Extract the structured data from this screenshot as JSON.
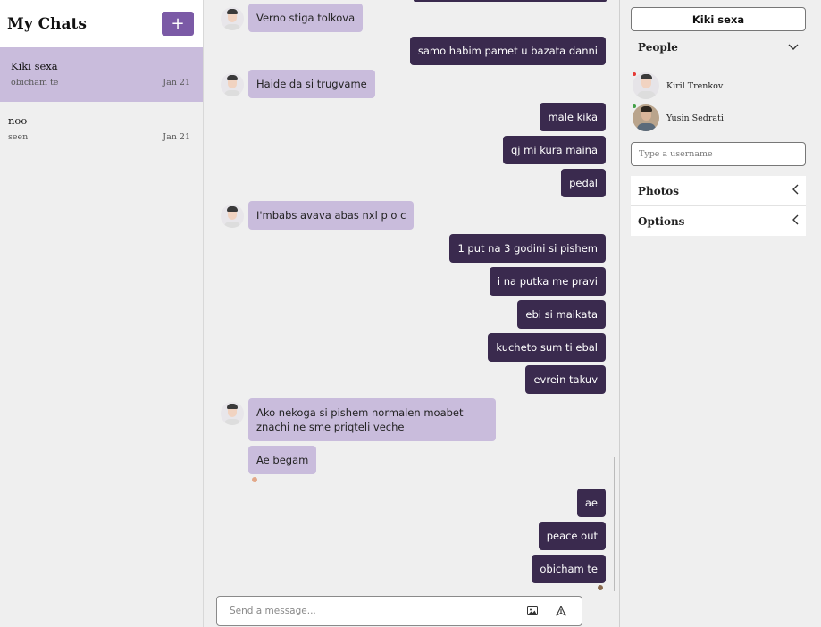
{
  "sidebar": {
    "title": "My Chats",
    "new_chat_label": "+",
    "chats": [
      {
        "name": "Kiki sexa",
        "last": "obicham te",
        "date": "Jan 21"
      },
      {
        "name": "noo",
        "last": "seen",
        "date": "Jan 21"
      }
    ]
  },
  "messages": [
    {
      "side": "in",
      "text": "Verno stiga tolkova"
    },
    {
      "side": "out",
      "text": "samo habim pamet u bazata danni"
    },
    {
      "side": "in",
      "text": "Haide da si trugvame"
    },
    {
      "side": "out",
      "text": "male kika"
    },
    {
      "side": "out",
      "text": "qj mi kura maina"
    },
    {
      "side": "out",
      "text": "pedal"
    },
    {
      "side": "in",
      "text": "I'mbabs avava abas nxl p o c"
    },
    {
      "side": "out",
      "text": "1 put na 3 godini si pishem"
    },
    {
      "side": "out",
      "text": "i na putka me pravi"
    },
    {
      "side": "out",
      "text": "ebi si maikata"
    },
    {
      "side": "out",
      "text": "kucheto sum ti ebal"
    },
    {
      "side": "out",
      "text": "evrein takuv"
    },
    {
      "side": "in",
      "text": "Ako nekoga si pishem normalen moabet znachi ne sme priqteli veche"
    },
    {
      "side": "in",
      "text": "Ae begam"
    },
    {
      "side": "out",
      "text": "ae"
    },
    {
      "side": "out",
      "text": "peace out"
    },
    {
      "side": "out",
      "text": "obicham te"
    }
  ],
  "composer": {
    "placeholder": "Send a message...",
    "image_icon": "image-icon",
    "send_icon": "send-icon"
  },
  "panel": {
    "chat_title": "Kiki sexa",
    "people_label": "People",
    "people": [
      {
        "name": "Kiril Trenkov",
        "status_color": "#e53935"
      },
      {
        "name": "Yusin Sedrati",
        "status_color": "#43a047"
      }
    ],
    "username_placeholder": "Type a username",
    "photos_label": "Photos",
    "options_label": "Options"
  },
  "colors": {
    "accent": "#7b5aa6",
    "incoming_bubble": "#c9bcdc",
    "outgoing_bubble": "#3a2a4e"
  }
}
